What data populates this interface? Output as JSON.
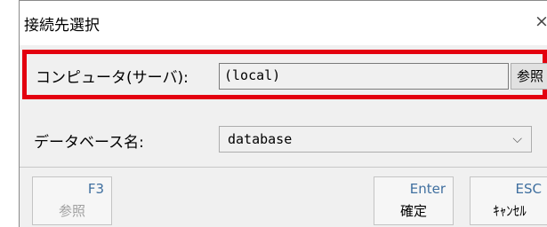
{
  "window": {
    "title": "接続先選択",
    "close_glyph": "×"
  },
  "server": {
    "label": "コンピュータ(サーバ):",
    "value": "(local)",
    "browse_label": "参照"
  },
  "database": {
    "label": "データベース名:",
    "value": "database",
    "chevron": "⌵"
  },
  "footer": {
    "f3": {
      "key": "F3",
      "label": "参照"
    },
    "enter": {
      "key": "Enter",
      "label": "確定"
    },
    "esc": {
      "key": "ESC",
      "label": "ｷｬﾝｾﾙ"
    }
  },
  "colors": {
    "highlight": "#e3000f",
    "key_text": "#3f6f9f"
  }
}
